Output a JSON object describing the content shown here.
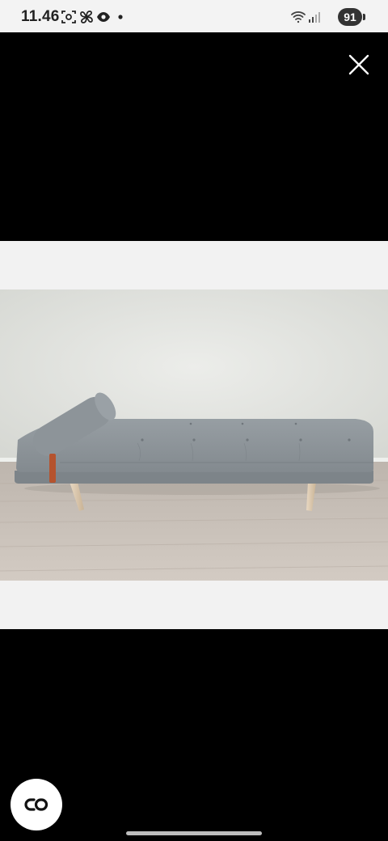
{
  "status_bar": {
    "time": "11.46",
    "battery": "91",
    "icons": [
      "screenshot-icon",
      "fan-icon",
      "eye-icon",
      "notification-dot-icon",
      "wifi-icon",
      "signal-icon"
    ]
  },
  "viewer": {
    "close_icon": "close-icon",
    "photo_subject": "sofa-daybed-photo",
    "lens_button_icon": "lens-icon"
  },
  "colors": {
    "background": "#000000",
    "frame": "#f2f2f2",
    "wall": "#e3e4e0",
    "floor": "#c8bfb6",
    "upholstery": "#8a9196",
    "leg": "#dcc8ae",
    "strap": "#b5532e"
  }
}
